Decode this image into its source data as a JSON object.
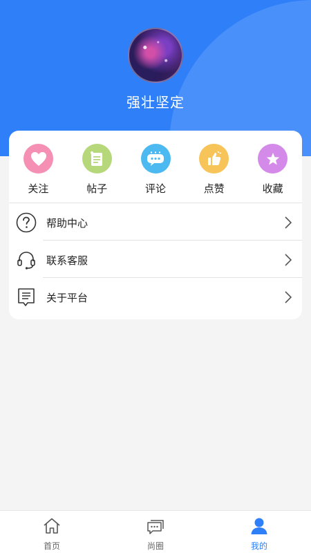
{
  "profile": {
    "username": "强壮坚定"
  },
  "stats": [
    {
      "label": "关注",
      "icon": "heart-icon",
      "color": "#f590b4"
    },
    {
      "label": "帖子",
      "icon": "note-icon",
      "color": "#b6d77a"
    },
    {
      "label": "评论",
      "icon": "comment-icon",
      "color": "#4cbaf0"
    },
    {
      "label": "点赞",
      "icon": "thumbs-up-icon",
      "color": "#f7c45a"
    },
    {
      "label": "收藏",
      "icon": "star-icon",
      "color": "#d48ae8"
    }
  ],
  "menu": [
    {
      "label": "帮助中心",
      "icon": "question-circle-icon"
    },
    {
      "label": "联系客服",
      "icon": "headset-icon"
    },
    {
      "label": "关于平台",
      "icon": "document-icon"
    }
  ],
  "tabbar": {
    "active": "我的",
    "items": [
      {
        "label": "首页",
        "icon": "home-icon"
      },
      {
        "label": "尚圈",
        "icon": "chat-icon"
      },
      {
        "label": "我的",
        "icon": "user-icon"
      }
    ]
  },
  "colors": {
    "header": "#2f7ff8",
    "accent": "#2f7ff8"
  }
}
